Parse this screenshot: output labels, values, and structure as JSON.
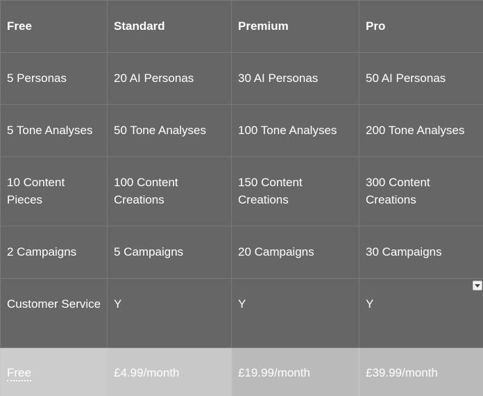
{
  "header": {
    "columns": [
      "Free",
      "Standard",
      "Premium",
      "Pro"
    ]
  },
  "rows": [
    [
      "5 Personas",
      "20 AI Personas",
      "30 AI Personas",
      "50 AI Personas"
    ],
    [
      "5 Tone Analyses",
      "50 Tone Analyses",
      "100 Tone Analyses",
      "200 Tone Analyses"
    ],
    [
      "10 Content Pieces",
      "100 Content Creations",
      "150 Content Creations",
      "300 Content Creations"
    ],
    [
      "2 Campaigns",
      "5 Campaigns",
      "20 Campaigns",
      "30 Campaigns"
    ],
    [
      "Customer Service",
      "Y",
      "Y",
      "Y"
    ]
  ],
  "prices": [
    "Free",
    "£4.99/month",
    "£19.99/month",
    "£39.99/month"
  ],
  "icons": {
    "dropdown": "chevron-down-icon"
  },
  "colors": {
    "cell_bg": "#666666",
    "cell_border": "#7a7a7a",
    "price_bg_free": "#cccccc",
    "price_bg_paid": "#bababa",
    "text": "#ffffff"
  }
}
